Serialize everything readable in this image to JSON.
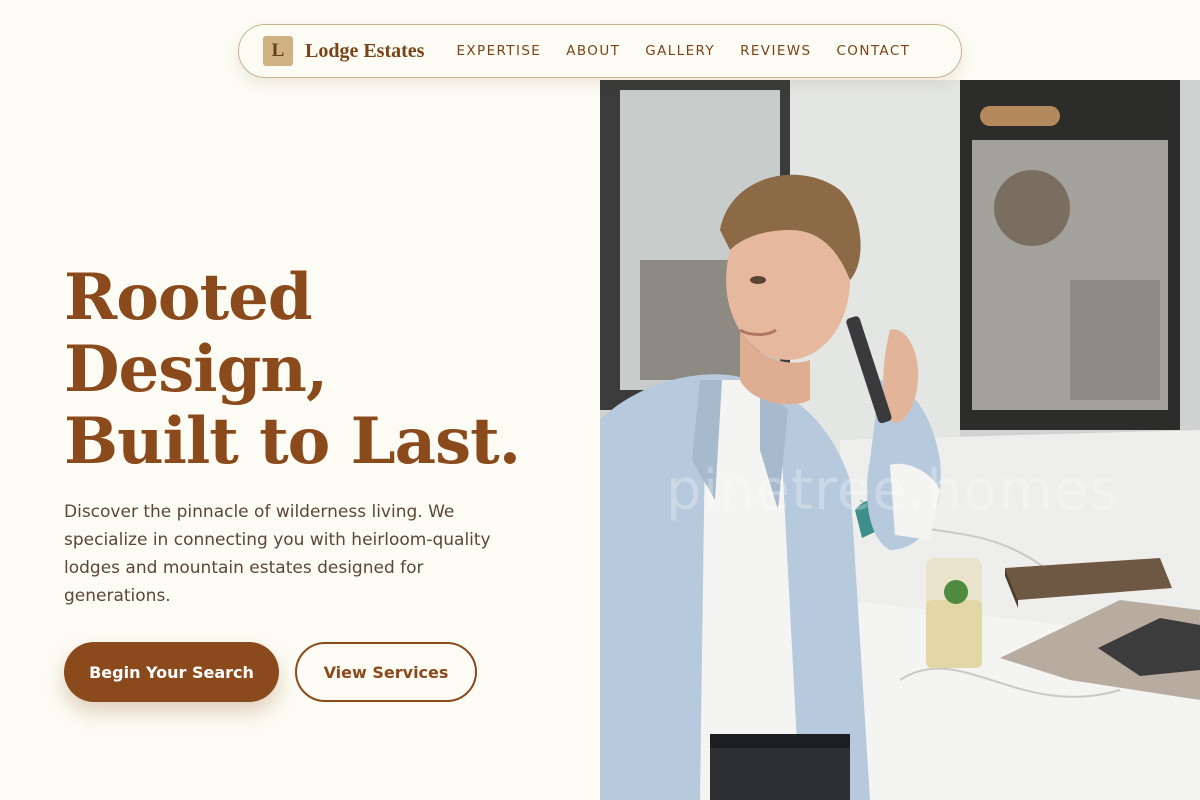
{
  "brand": {
    "logo_letter": "L",
    "name": "Lodge Estates"
  },
  "nav": {
    "links": [
      {
        "label": "EXPERTISE"
      },
      {
        "label": "ABOUT"
      },
      {
        "label": "GALLERY"
      },
      {
        "label": "REVIEWS"
      },
      {
        "label": "CONTACT"
      }
    ]
  },
  "hero": {
    "headline_lines": [
      "Rooted",
      "Design,",
      "Built to Last."
    ],
    "description": "Discover the pinnacle of wilderness living. We specialize in connecting you with heirloom-quality lodges and mountain estates designed for generations.",
    "primary_cta": "Begin Your Search",
    "secondary_cta": "View Services",
    "image": {
      "subject": "man in light blue blazer talking on phone at marble counter",
      "watermark": "pinetree.homes"
    }
  },
  "colors": {
    "accent": "#8a4a1c",
    "background": "#fdfcf4",
    "logo_badge": "#d0b184"
  }
}
